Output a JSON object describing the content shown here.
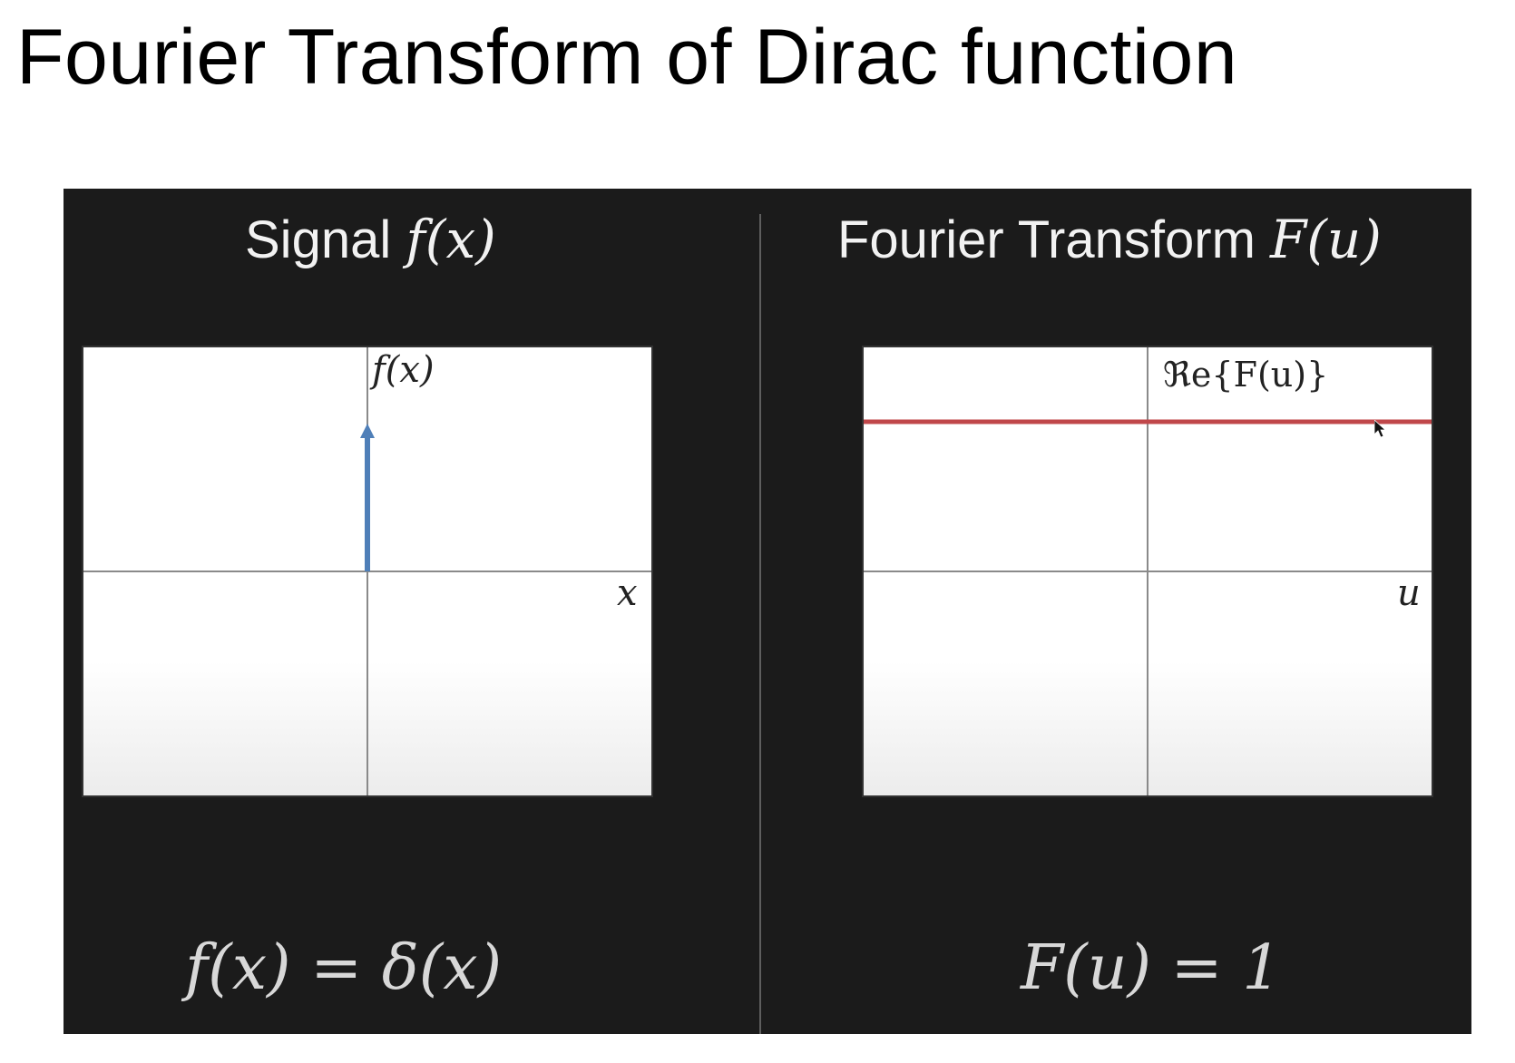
{
  "slide": {
    "title": "Fourier Transform of Dirac function"
  },
  "left_panel": {
    "title_text": "Signal ",
    "title_math": "f(x)",
    "y_label": "f(x)",
    "x_label": "x",
    "formula": "f(x) = δ(x)",
    "impulse_color": "#4f7fb8"
  },
  "right_panel": {
    "title_text": "Fourier Transform ",
    "title_math": "F(u)",
    "y_label": "ℜe{F(u)}",
    "x_label": "u",
    "formula": "F(u) = 1",
    "line_color": "#c0474a"
  },
  "chart_data": [
    {
      "type": "line",
      "series": [
        {
          "x": [
            0,
            0
          ],
          "y": [
            0,
            1
          ]
        }
      ],
      "note_marker": "impulse-arrow-at-origin"
    },
    {
      "type": "line",
      "series": [
        {
          "x": [
            -1,
            1
          ],
          "y": [
            1,
            1
          ]
        }
      ]
    }
  ]
}
